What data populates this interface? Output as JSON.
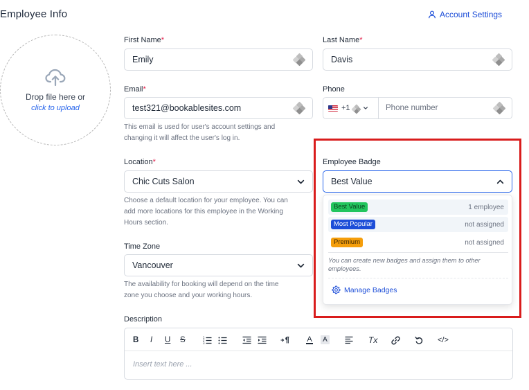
{
  "page": {
    "title": "Employee Info"
  },
  "header": {
    "account_settings_label": "Account Settings",
    "account_icon": "user-icon"
  },
  "upload": {
    "line1": "Drop file here or",
    "line2": "click to upload",
    "icon": "cloud-upload-icon"
  },
  "form": {
    "required_mark": "*",
    "first_name": {
      "label": "First Name",
      "value": "Emily",
      "required": true
    },
    "last_name": {
      "label": "Last Name",
      "value": "Davis",
      "required": true
    },
    "email": {
      "label": "Email",
      "value": "test321@bookablesites.com",
      "required": true,
      "help_line1": "This email is used for user's account settings and",
      "help_line2": "changing it will affect the user's log in."
    },
    "phone": {
      "label": "Phone",
      "country_code": "+1",
      "placeholder": "Phone number",
      "flag_icon": "us-flag-icon"
    },
    "location": {
      "label": "Location",
      "value": "Chic Cuts Salon",
      "required": true,
      "help_line1": "Choose a default location for your employee. You can",
      "help_line2": "add more locations for this employee in the Working",
      "help_line3": "Hours section."
    },
    "time_zone": {
      "label": "Time Zone",
      "value": "Vancouver",
      "help_line1": "The availability for booking will depend on the time",
      "help_line2": "zone you choose and your working hours."
    },
    "employee_badge": {
      "label": "Employee Badge",
      "value": "Best Value",
      "options": [
        {
          "name": "Best Value",
          "count": "1 employee",
          "bg": "#22c55e",
          "fg": "#0b3d1c"
        },
        {
          "name": "Most Popular",
          "count": "not assigned",
          "bg": "#1d4ed8",
          "fg": "#ffffff"
        },
        {
          "name": "Premium",
          "count": "not assigned",
          "bg": "#f59e0b",
          "fg": "#3a2400"
        }
      ],
      "note_line1": "You can create new badges and assign them to other",
      "note_line2": "employees.",
      "manage_label": "Manage Badges",
      "manage_icon": "gear-icon"
    },
    "description": {
      "label": "Description",
      "placeholder": "Insert text here ...",
      "toolbar": {
        "bold": "B",
        "italic": "I",
        "underline": "U",
        "strike": "S",
        "ordered_list": "ordered-list-icon",
        "bullet_list": "bullet-list-icon",
        "outdent": "outdent-icon",
        "indent": "indent-icon",
        "direction": "text-direction-icon",
        "text_color": "A",
        "bg_color": "A",
        "align": "align-icon",
        "clear_format": "Tx",
        "link": "link-icon",
        "undo": "undo-icon",
        "code": "</>"
      }
    }
  },
  "colors": {
    "accent": "#2563eb",
    "required": "#e11d48",
    "highlight_border": "#d91c1c"
  }
}
